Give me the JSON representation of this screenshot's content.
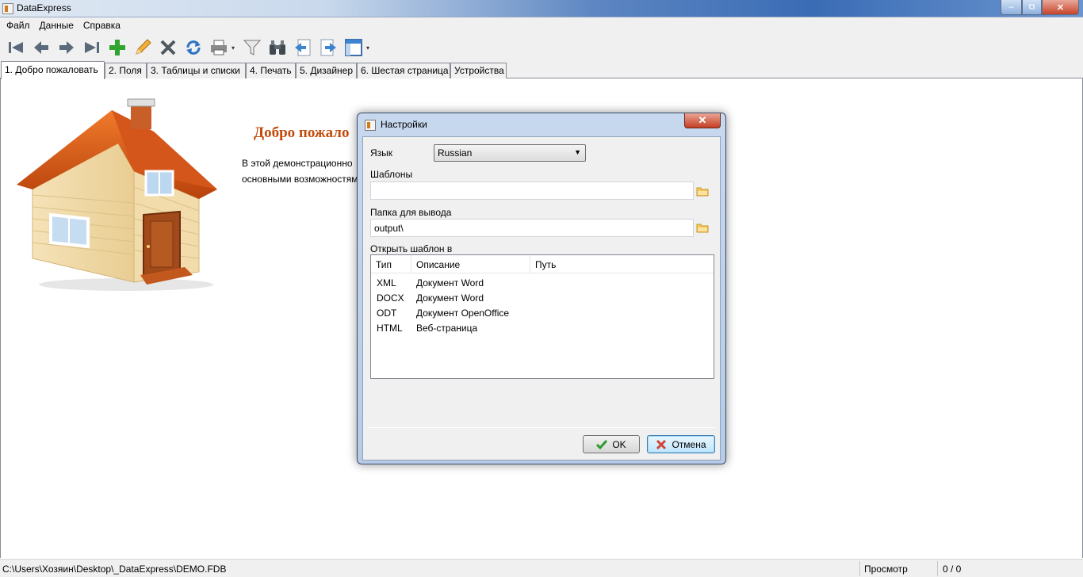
{
  "window": {
    "title": "DataExpress",
    "minimize": "–",
    "maximize": "⧉",
    "close": "✕"
  },
  "menu": {
    "items": [
      "Файл",
      "Данные",
      "Справка"
    ]
  },
  "toolbar": {
    "buttons": [
      "first-icon",
      "prev-icon",
      "next-icon",
      "last-icon",
      "add-icon",
      "edit-icon",
      "delete-icon",
      "refresh-icon",
      "print-icon",
      "filter-icon",
      "find-icon",
      "import-icon",
      "export-icon",
      "layout-icon"
    ],
    "dropdown_arrow": "▾"
  },
  "tabs": [
    {
      "label": "1. Добро пожаловать",
      "active": true
    },
    {
      "label": "2. Поля"
    },
    {
      "label": "3. Таблицы и списки"
    },
    {
      "label": "4. Печать"
    },
    {
      "label": "5. Дизайнер"
    },
    {
      "label": "6. Шестая страница"
    },
    {
      "label": "Устройства"
    }
  ],
  "welcome": {
    "title": "Добро пожало",
    "line1": "В этой демонстрационно",
    "line2": "основными возможностям"
  },
  "status": {
    "path": "C:\\Users\\Хозяин\\Desktop\\_DataExpress\\DEMO.FDB",
    "mode": "Просмотр",
    "count": "0 / 0"
  },
  "dialog": {
    "title": "Настройки",
    "close": "✕",
    "language_label": "Язык",
    "language_value": "Russian",
    "templates_label": "Шаблоны",
    "templates_value": "",
    "output_label": "Папка для вывода",
    "output_value": "output\\",
    "open_template_label": "Открыть шаблон в",
    "columns": [
      "Тип",
      "Описание",
      "Путь"
    ],
    "rows": [
      {
        "type": "XML",
        "desc": "Документ Word",
        "path": ""
      },
      {
        "type": "DOCX",
        "desc": "Документ Word",
        "path": ""
      },
      {
        "type": "ODT",
        "desc": "Документ OpenOffice",
        "path": ""
      },
      {
        "type": "HTML",
        "desc": "Веб-страница",
        "path": ""
      }
    ],
    "ok_label": "OK",
    "cancel_label": "Отмена"
  },
  "colors": {
    "accent_title": "#c24b09",
    "tab_border": "#898c95"
  }
}
